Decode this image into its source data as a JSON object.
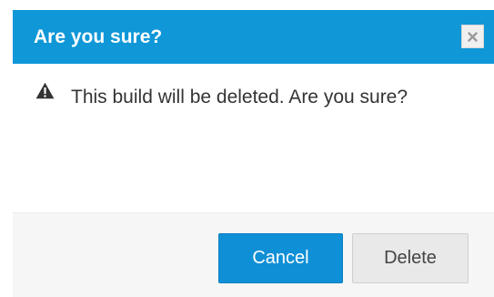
{
  "dialog": {
    "title": "Are you sure?",
    "message": "This build will be deleted. Are you sure?",
    "close_icon": "close-icon",
    "warning_icon": "warning-icon",
    "buttons": {
      "cancel_label": "Cancel",
      "delete_label": "Delete"
    }
  },
  "colors": {
    "title_bar": "#0f97d8",
    "primary_button": "#0f8fd6",
    "secondary_button": "#e9e9e9",
    "footer": "#f6f6f6"
  }
}
